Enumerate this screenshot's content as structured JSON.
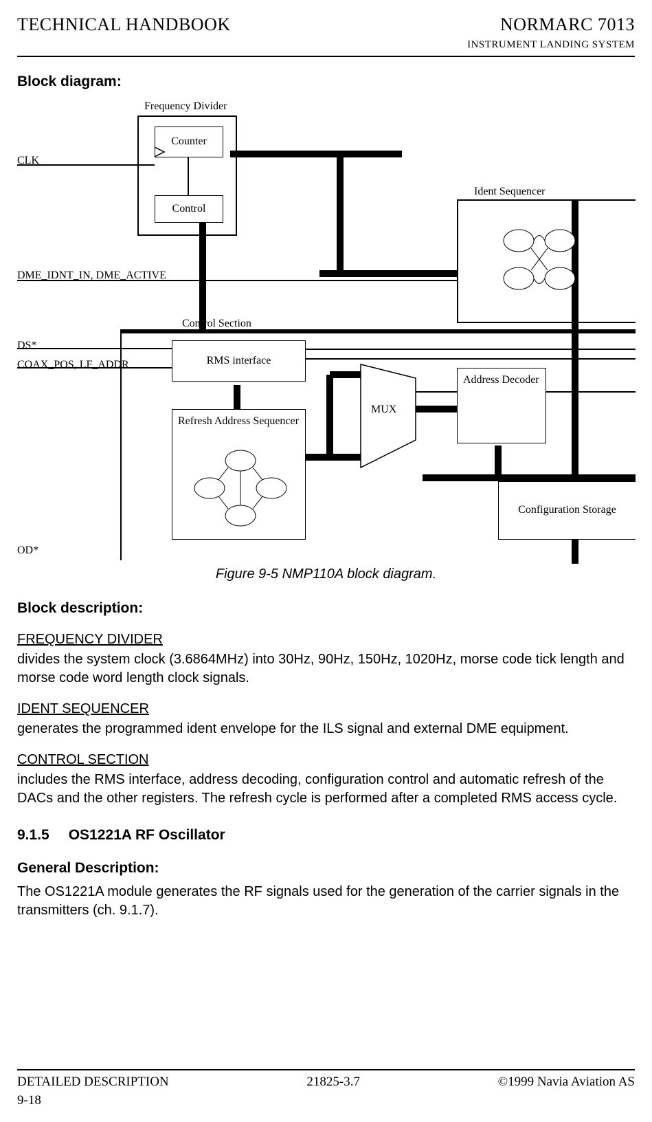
{
  "header": {
    "left": "TECHNICAL HANDBOOK",
    "right1": "NORMARC 7013",
    "right2": "INSTRUMENT LANDING SYSTEM"
  },
  "blockDiagramTitle": "Block diagram:",
  "diagram": {
    "freqDivider": "Frequency Divider",
    "counter": "Counter",
    "control": "Control",
    "clk": "CLK",
    "dme": "DME_IDNT_IN, DME_ACTIVE",
    "identSeq": "Ident Sequencer",
    "controlSection": "Control Section",
    "ds": "DS*",
    "coax": "COAX_POS, LF_ADDR",
    "rms": "RMS interface",
    "refresh": "Refresh Address\nSequencer",
    "mux": "MUX",
    "addrDec": "Address\nDecoder",
    "cfgStore": "Configuration\nStorage",
    "od": "OD*"
  },
  "caption": "Figure 9-5 NMP110A block diagram.",
  "descTitle": "Block description:",
  "freqDiv": {
    "head": "FREQUENCY DIVIDER",
    "body": "divides the system clock (3.6864MHz) into 30Hz, 90Hz, 150Hz, 1020Hz, morse code tick length and morse code word length clock signals."
  },
  "identSeq": {
    "head": "IDENT SEQUENCER",
    "body": "generates the programmed ident envelope for the ILS signal and external DME equipment."
  },
  "ctrlSec": {
    "head": "CONTROL SECTION",
    "body": "includes the RMS interface, address decoding, configuration control and automatic refresh of the DACs and the other registers. The refresh cycle is performed after a completed RMS access cycle."
  },
  "secNum": "9.1.5",
  "secTitle": "OS1221A RF Oscillator",
  "genDescTitle": "General Description:",
  "genDescBody": "The OS1221A module generates the RF signals used for the generation of the carrier signals in the transmitters (ch. 9.1.7).",
  "footer": {
    "left": "DETAILED DESCRIPTION",
    "center": "21825-3.7",
    "right": "©1999 Navia Aviation AS",
    "page": "9-18"
  }
}
